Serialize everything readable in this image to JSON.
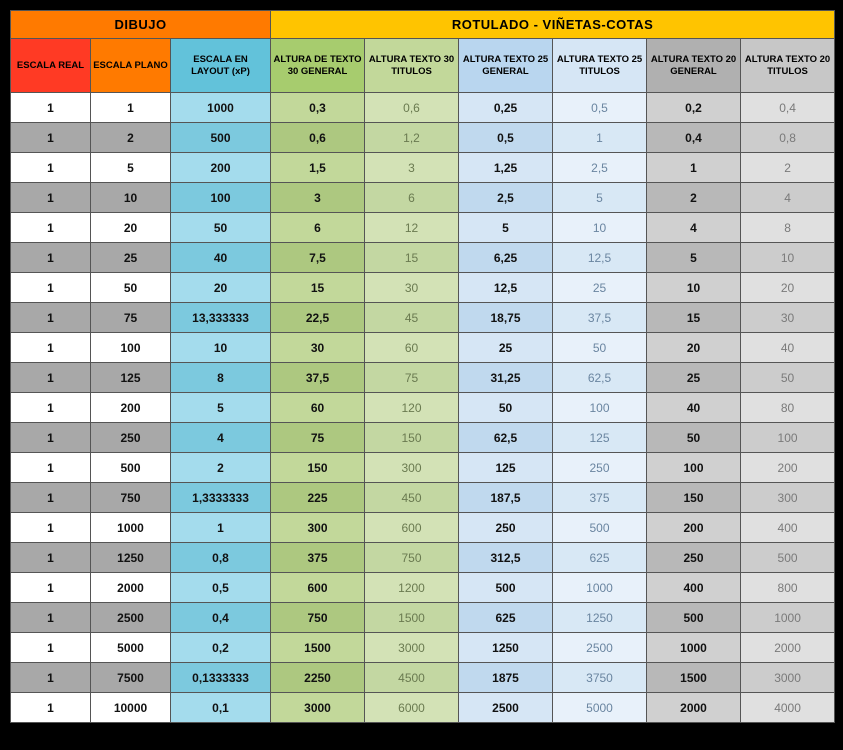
{
  "sections": {
    "dibujo": "DIBUJO",
    "rotulado": "ROTULADO - VIÑETAS-COTAS"
  },
  "headers": {
    "real": "ESCALA REAL",
    "plano": "ESCALA PLANO",
    "layout": "ESCALA EN LAYOUT (xP)",
    "g30g": "ALTURA DE TEXTO 30 GENERAL",
    "g30t": "ALTURA TEXTO 30 TITULOS",
    "g25g": "ALTURA TEXTO 25 GENERAL",
    "g25t": "ALTURA TEXTO 25 TITULOS",
    "g20g": "ALTURA TEXTO 20 GENERAL",
    "g20t": "ALTURA TEXTO 20 TITULOS"
  },
  "rows": [
    {
      "real": "1",
      "plano": "1",
      "layout": "1000",
      "g30g": "0,3",
      "g30t": "0,6",
      "g25g": "0,25",
      "g25t": "0,5",
      "g20g": "0,2",
      "g20t": "0,4"
    },
    {
      "real": "1",
      "plano": "2",
      "layout": "500",
      "g30g": "0,6",
      "g30t": "1,2",
      "g25g": "0,5",
      "g25t": "1",
      "g20g": "0,4",
      "g20t": "0,8"
    },
    {
      "real": "1",
      "plano": "5",
      "layout": "200",
      "g30g": "1,5",
      "g30t": "3",
      "g25g": "1,25",
      "g25t": "2,5",
      "g20g": "1",
      "g20t": "2"
    },
    {
      "real": "1",
      "plano": "10",
      "layout": "100",
      "g30g": "3",
      "g30t": "6",
      "g25g": "2,5",
      "g25t": "5",
      "g20g": "2",
      "g20t": "4"
    },
    {
      "real": "1",
      "plano": "20",
      "layout": "50",
      "g30g": "6",
      "g30t": "12",
      "g25g": "5",
      "g25t": "10",
      "g20g": "4",
      "g20t": "8"
    },
    {
      "real": "1",
      "plano": "25",
      "layout": "40",
      "g30g": "7,5",
      "g30t": "15",
      "g25g": "6,25",
      "g25t": "12,5",
      "g20g": "5",
      "g20t": "10"
    },
    {
      "real": "1",
      "plano": "50",
      "layout": "20",
      "g30g": "15",
      "g30t": "30",
      "g25g": "12,5",
      "g25t": "25",
      "g20g": "10",
      "g20t": "20"
    },
    {
      "real": "1",
      "plano": "75",
      "layout": "13,333333",
      "g30g": "22,5",
      "g30t": "45",
      "g25g": "18,75",
      "g25t": "37,5",
      "g20g": "15",
      "g20t": "30"
    },
    {
      "real": "1",
      "plano": "100",
      "layout": "10",
      "g30g": "30",
      "g30t": "60",
      "g25g": "25",
      "g25t": "50",
      "g20g": "20",
      "g20t": "40"
    },
    {
      "real": "1",
      "plano": "125",
      "layout": "8",
      "g30g": "37,5",
      "g30t": "75",
      "g25g": "31,25",
      "g25t": "62,5",
      "g20g": "25",
      "g20t": "50"
    },
    {
      "real": "1",
      "plano": "200",
      "layout": "5",
      "g30g": "60",
      "g30t": "120",
      "g25g": "50",
      "g25t": "100",
      "g20g": "40",
      "g20t": "80"
    },
    {
      "real": "1",
      "plano": "250",
      "layout": "4",
      "g30g": "75",
      "g30t": "150",
      "g25g": "62,5",
      "g25t": "125",
      "g20g": "50",
      "g20t": "100"
    },
    {
      "real": "1",
      "plano": "500",
      "layout": "2",
      "g30g": "150",
      "g30t": "300",
      "g25g": "125",
      "g25t": "250",
      "g20g": "100",
      "g20t": "200"
    },
    {
      "real": "1",
      "plano": "750",
      "layout": "1,3333333",
      "g30g": "225",
      "g30t": "450",
      "g25g": "187,5",
      "g25t": "375",
      "g20g": "150",
      "g20t": "300"
    },
    {
      "real": "1",
      "plano": "1000",
      "layout": "1",
      "g30g": "300",
      "g30t": "600",
      "g25g": "250",
      "g25t": "500",
      "g20g": "200",
      "g20t": "400"
    },
    {
      "real": "1",
      "plano": "1250",
      "layout": "0,8",
      "g30g": "375",
      "g30t": "750",
      "g25g": "312,5",
      "g25t": "625",
      "g20g": "250",
      "g20t": "500"
    },
    {
      "real": "1",
      "plano": "2000",
      "layout": "0,5",
      "g30g": "600",
      "g30t": "1200",
      "g25g": "500",
      "g25t": "1000",
      "g20g": "400",
      "g20t": "800"
    },
    {
      "real": "1",
      "plano": "2500",
      "layout": "0,4",
      "g30g": "750",
      "g30t": "1500",
      "g25g": "625",
      "g25t": "1250",
      "g20g": "500",
      "g20t": "1000"
    },
    {
      "real": "1",
      "plano": "5000",
      "layout": "0,2",
      "g30g": "1500",
      "g30t": "3000",
      "g25g": "1250",
      "g25t": "2500",
      "g20g": "1000",
      "g20t": "2000"
    },
    {
      "real": "1",
      "plano": "7500",
      "layout": "0,1333333",
      "g30g": "2250",
      "g30t": "4500",
      "g25g": "1875",
      "g25t": "3750",
      "g20g": "1500",
      "g20t": "3000"
    },
    {
      "real": "1",
      "plano": "10000",
      "layout": "0,1",
      "g30g": "3000",
      "g30t": "6000",
      "g25g": "2500",
      "g25t": "5000",
      "g20g": "2000",
      "g20t": "4000"
    }
  ]
}
